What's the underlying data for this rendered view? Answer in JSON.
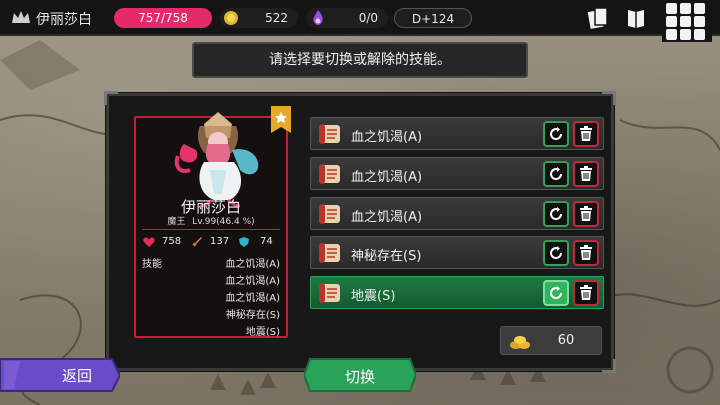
{
  "header": {
    "character_name": "伊丽莎白",
    "hp": "757/758",
    "gold": "522",
    "souls": "0/0",
    "day": "D+124"
  },
  "banner": {
    "text": "请选择要切换或解除的技能。"
  },
  "character_card": {
    "name": "伊丽莎白",
    "class": "魔王",
    "level": "Lv.99(46.4 %)",
    "hp": "758",
    "attack": "137",
    "defense": "74",
    "skills_label": "技能",
    "skills": [
      "血之饥渴(A)",
      "血之饥渴(A)",
      "血之饥渴(A)",
      "神秘存在(S)",
      "地震(S)"
    ]
  },
  "skill_rows": [
    {
      "label": "血之饥渴(A)",
      "selected": false
    },
    {
      "label": "血之饥渴(A)",
      "selected": false
    },
    {
      "label": "血之饥渴(A)",
      "selected": false
    },
    {
      "label": "神秘存在(S)",
      "selected": false
    },
    {
      "label": "地震(S)",
      "selected": true
    }
  ],
  "cost": {
    "value": "60"
  },
  "buttons": {
    "back": "返回",
    "switch": "切换"
  },
  "colors": {
    "hp_accent": "#e6296a",
    "card_border": "#c81d3a",
    "selected_row": "#1f7a43",
    "refresh_border": "#2fa35c",
    "delete_border": "#c02a3a",
    "back_button": "#6a4bc8",
    "switch_button": "#2aa35a"
  }
}
